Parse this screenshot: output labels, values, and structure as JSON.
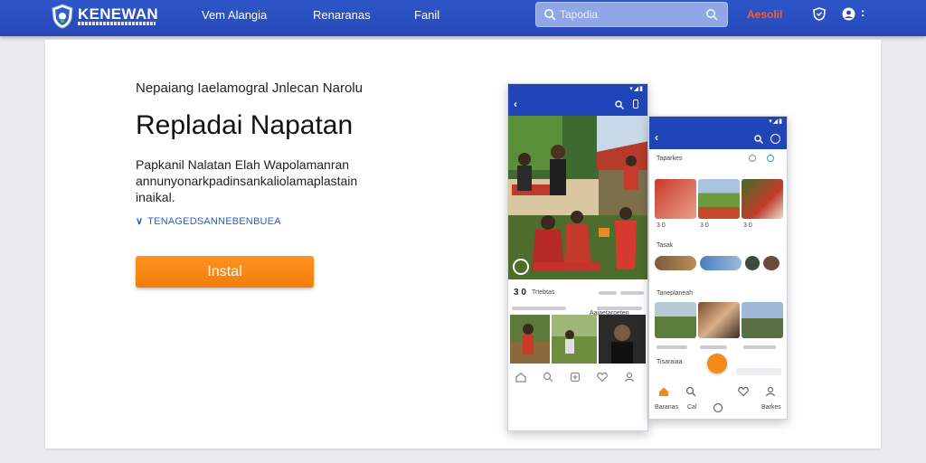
{
  "header": {
    "brand": "KENEWAN",
    "nav": [
      "Vem Alangia",
      "Renaranas",
      "Fanil"
    ],
    "search_placeholder": "Tapodia",
    "login": "Aesolil"
  },
  "hero": {
    "eyebrow": "Nepaiang Iaelamogral Jnlecan Narolu",
    "headline": "Repladai Napatan",
    "description": "Papkanil Nalatan Elah Wapolamanran annunyonarkpadinsankaliolamaplastain inaikal.",
    "feature": "TENAGEDSANNEBENBUEA",
    "install_label": "Instal"
  },
  "phone1": {
    "stats": "3 0",
    "stats_label": "Trtebtas",
    "caption": "Aaiaetarpeten"
  },
  "phone2": {
    "section1": "Taparkes",
    "row1_labels": [
      "3 0",
      "3 0",
      "3 0"
    ],
    "section2": "Tasak",
    "section3": "Taneplaneah",
    "item_label": "Tisaraiaa",
    "bottom_labels": [
      "Baranas",
      "Cal",
      "Barkes"
    ]
  },
  "colors": {
    "brand_blue": "#2548b8",
    "accent_orange": "#f27c0a",
    "link_blue": "#2b62c4",
    "login_red": "#ff5a36"
  }
}
